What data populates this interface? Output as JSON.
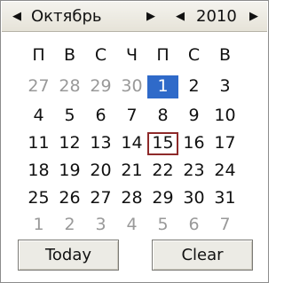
{
  "header": {
    "month_prev_arrow": "◀",
    "month": "Октябрь",
    "month_next_arrow": "▶",
    "year_prev_arrow": "◀",
    "year": "2010",
    "year_next_arrow": "▶"
  },
  "weekdays": [
    "П",
    "В",
    "С",
    "Ч",
    "П",
    "С",
    "В"
  ],
  "weeks": [
    [
      {
        "d": "27",
        "other": true
      },
      {
        "d": "28",
        "other": true
      },
      {
        "d": "29",
        "other": true
      },
      {
        "d": "30",
        "other": true
      },
      {
        "d": "1",
        "selected": true
      },
      {
        "d": "2"
      },
      {
        "d": "3"
      }
    ],
    [
      {
        "d": "4"
      },
      {
        "d": "5"
      },
      {
        "d": "6"
      },
      {
        "d": "7"
      },
      {
        "d": "8"
      },
      {
        "d": "9"
      },
      {
        "d": "10"
      }
    ],
    [
      {
        "d": "11"
      },
      {
        "d": "12"
      },
      {
        "d": "13"
      },
      {
        "d": "14"
      },
      {
        "d": "15",
        "today": true
      },
      {
        "d": "16"
      },
      {
        "d": "17"
      }
    ],
    [
      {
        "d": "18"
      },
      {
        "d": "19"
      },
      {
        "d": "20"
      },
      {
        "d": "21"
      },
      {
        "d": "22"
      },
      {
        "d": "23"
      },
      {
        "d": "24"
      }
    ],
    [
      {
        "d": "25"
      },
      {
        "d": "26"
      },
      {
        "d": "27"
      },
      {
        "d": "28"
      },
      {
        "d": "29"
      },
      {
        "d": "30"
      },
      {
        "d": "31"
      }
    ],
    [
      {
        "d": "1",
        "other": true
      },
      {
        "d": "2",
        "other": true
      },
      {
        "d": "3",
        "other": true
      },
      {
        "d": "4",
        "other": true
      },
      {
        "d": "5",
        "other": true
      },
      {
        "d": "6",
        "other": true
      },
      {
        "d": "7",
        "other": true
      }
    ]
  ],
  "buttons": {
    "today": "Today",
    "clear": "Clear"
  },
  "colors": {
    "selected_bg": "#2f6ac9",
    "today_border": "#8e2a2a",
    "other_month_text": "#999999"
  }
}
